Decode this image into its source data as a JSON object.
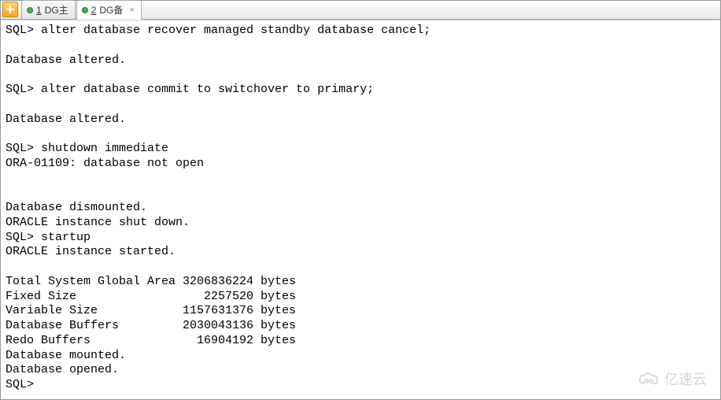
{
  "tabs": [
    {
      "num": "1",
      "label": "DG主",
      "active": false
    },
    {
      "num": "2",
      "label": "DG备",
      "active": true
    }
  ],
  "terminal_lines": [
    "SQL> alter database recover managed standby database cancel;",
    "",
    "Database altered.",
    "",
    "SQL> alter database commit to switchover to primary;",
    "",
    "Database altered.",
    "",
    "SQL> shutdown immediate",
    "ORA-01109: database not open",
    "",
    "",
    "Database dismounted.",
    "ORACLE instance shut down.",
    "SQL> startup",
    "ORACLE instance started.",
    "",
    "Total System Global Area 3206836224 bytes",
    "Fixed Size                  2257520 bytes",
    "Variable Size            1157631376 bytes",
    "Database Buffers         2030043136 bytes",
    "Redo Buffers               16904192 bytes",
    "Database mounted.",
    "Database opened.",
    "SQL>"
  ],
  "watermark_text": "亿速云"
}
